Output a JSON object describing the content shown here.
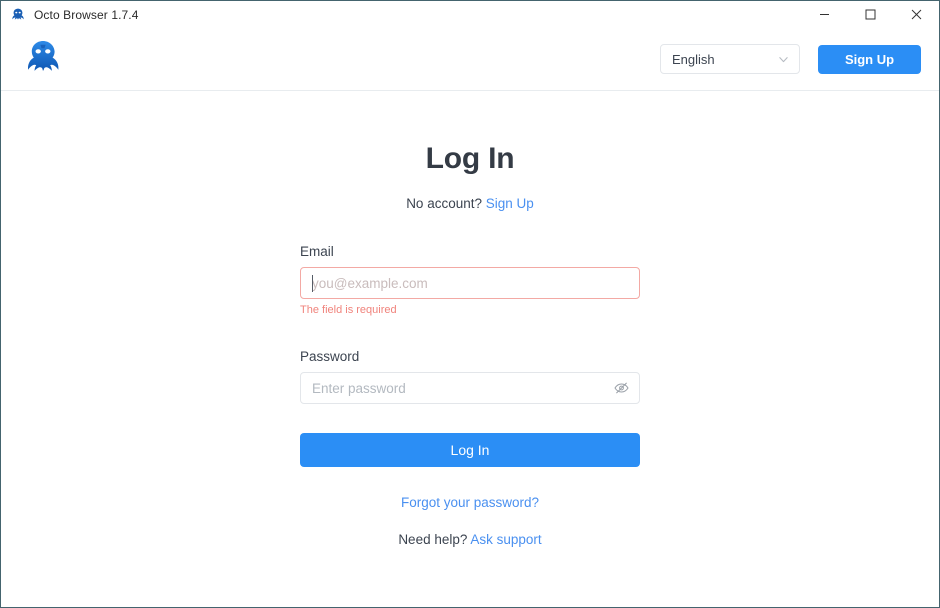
{
  "window": {
    "title": "Octo Browser 1.7.4",
    "app_icon": "octopus-icon",
    "controls": {
      "minimize": "minimize-icon",
      "maximize": "maximize-icon",
      "close": "close-icon"
    }
  },
  "header": {
    "logo": "octo-browser-logo",
    "language": {
      "value": "English",
      "chevron": "chevron-down-icon"
    },
    "signup_label": "Sign Up"
  },
  "main": {
    "title": "Log In",
    "subtitle_text": "No account?",
    "subtitle_link": "Sign Up",
    "email": {
      "label": "Email",
      "value": "",
      "placeholder": "you@example.com",
      "error": "The field is required"
    },
    "password": {
      "label": "Password",
      "value": "",
      "placeholder": "Enter password",
      "toggle_icon": "eye-off-icon"
    },
    "submit_label": "Log In",
    "forgot_label": "Forgot your password?",
    "help_text": "Need help?",
    "help_link": "Ask support"
  },
  "colors": {
    "accent": "#2b8ef5",
    "link": "#4a90f0",
    "error": "#f0837c",
    "error_border": "#f3a9a4",
    "title_text": "#343b45",
    "window_border": "#44646e"
  }
}
